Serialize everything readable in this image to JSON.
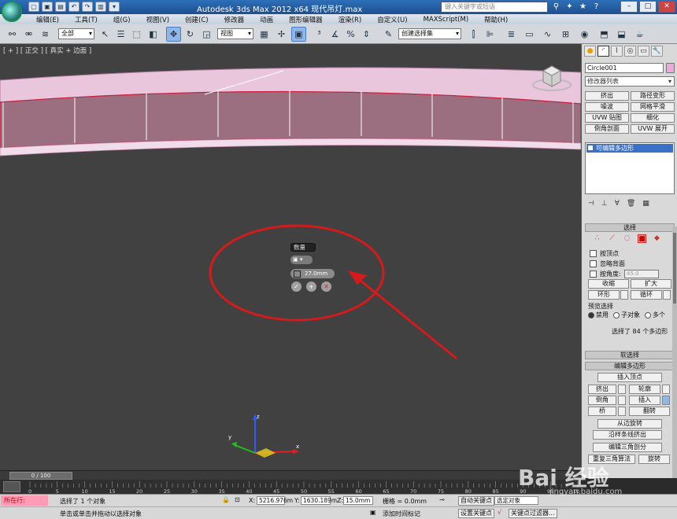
{
  "window": {
    "title": "Autodesk 3ds Max  2012 x64     现代吊灯.max",
    "search_placeholder": "键入关键字或短语"
  },
  "menu": [
    "编辑(E)",
    "工具(T)",
    "组(G)",
    "视图(V)",
    "创建(C)",
    "修改器",
    "动画",
    "图形编辑器",
    "渲染(R)",
    "自定义(U)",
    "MAXScript(M)",
    "帮助(H)"
  ],
  "toolbar": {
    "selection_filter": "全部",
    "reference_coord": "视图",
    "named_selection": "创建选择集"
  },
  "viewport": {
    "label": "[ + ] [ 正交 ] [ 真实 + 边面 ]",
    "caddy": {
      "title": "数量",
      "dropdown_icon": "grid-icon",
      "value": "27.0mm",
      "ok": "✓",
      "apply": "+",
      "cancel": "✕"
    },
    "annotation": {
      "type": "red-ellipse-with-arrow",
      "color": "#d41a1a"
    }
  },
  "command_panel": {
    "object_name": "Circle001",
    "object_color": "#f0a8dc",
    "modifier_list": "修改器列表",
    "modifier_buttons": [
      "挤出",
      "路径变形",
      "噪波",
      "网格平滑",
      "UVW 贴图",
      "细化",
      "倒角剖面",
      "UVW 展开"
    ],
    "stack_item": "可编辑多边形",
    "selection": {
      "title": "选择",
      "by_vertex": "按顶点",
      "ignore_backfacing": "忽略背面",
      "by_angle": "按角度:",
      "angle_value": "45.0",
      "shrink": "收缩",
      "grow": "扩大",
      "ring": "环形",
      "loop": "循环",
      "preview_title": "预览选择",
      "preview_options": [
        "禁用",
        "子对象",
        "多个"
      ],
      "status": "选择了 84 个多边形"
    },
    "soft_selection": "软选择",
    "edit_polygons": {
      "title": "编辑多边形",
      "insert_vertex": "插入顶点",
      "extrude": "挤出",
      "outline": "轮廓",
      "bevel": "倒角",
      "inset": "插入",
      "bridge": "桥",
      "flip": "翻转",
      "hinge": "从边旋转",
      "extrude_along_spline": "沿样条线挤出",
      "edit_triangulation": "编辑三角剖分",
      "retriangulate": "重复三角算法",
      "turn": "旋转"
    }
  },
  "timeline": {
    "slider": "0 / 100",
    "ticks": [
      "0",
      "5",
      "10",
      "15",
      "20",
      "25",
      "30",
      "35",
      "40",
      "45",
      "50",
      "55",
      "60",
      "65",
      "70",
      "75",
      "80",
      "85",
      "90",
      "95",
      "100"
    ]
  },
  "status": {
    "listener": "所在行:",
    "selected": "选择了 1 个对象",
    "prompt": "单击或单击并拖动以选择对象",
    "x_label": "X:",
    "x": "5216.976m",
    "y_label": "Y:",
    "y": "1630.189m",
    "z_label": "Z:",
    "z": "15.0mm",
    "grid": "栅格 = 0.0mm",
    "add_time_tag": "添加时间标记",
    "auto_key": "自动关键点",
    "key_filter_mode": "选定对象",
    "set_key": "设置关键点",
    "key_filters": "关键点过滤器..."
  },
  "watermark": {
    "brand": "Bai 经验",
    "url": "jingyan.baidu.com"
  }
}
